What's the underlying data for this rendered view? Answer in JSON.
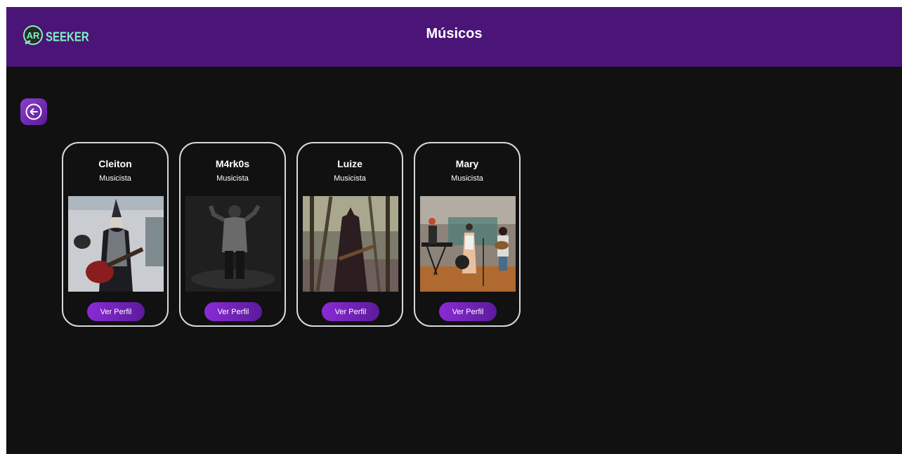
{
  "header": {
    "logo_text": "SEEKER",
    "title": "Músicos"
  },
  "back_button": {
    "icon": "arrow-left-circle-icon"
  },
  "colors": {
    "header_bg": "#4b1477",
    "page_bg": "#111111",
    "accent": "#8a2bd6",
    "logo_accent": "#7ff0c0"
  },
  "musicians": [
    {
      "name": "Cleiton",
      "role": "Musicista",
      "button": "Ver Perfil"
    },
    {
      "name": "M4rk0s",
      "role": "Musicista",
      "button": "Ver Perfil"
    },
    {
      "name": "Luize",
      "role": "Musicista",
      "button": "Ver Perfil"
    },
    {
      "name": "Mary",
      "role": "Musicista",
      "button": "Ver Perfil"
    }
  ]
}
